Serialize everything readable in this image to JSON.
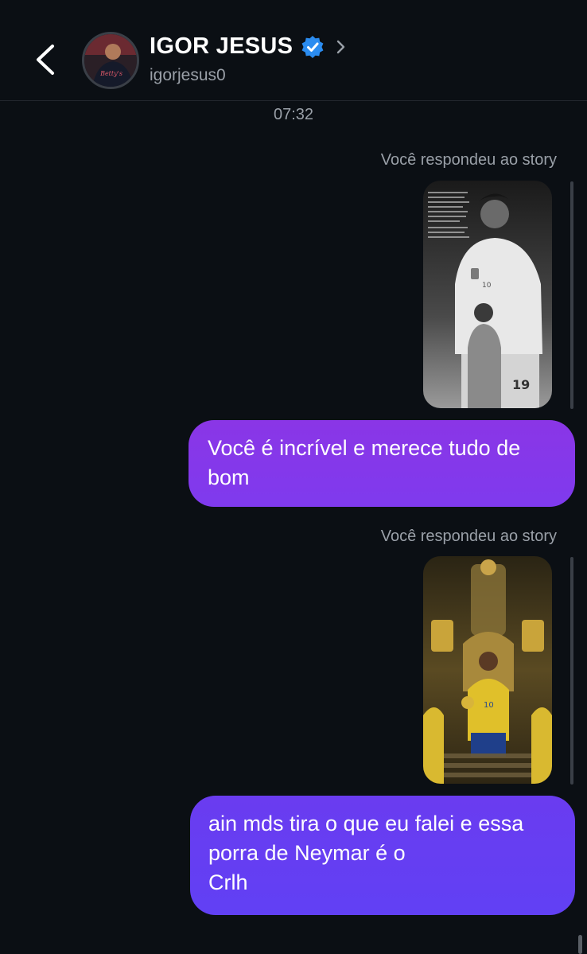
{
  "header": {
    "name": "IGOR JESUS",
    "handle": "igorjesus0",
    "back_icon": "chevron-left-icon",
    "verified_icon": "verified-badge-icon",
    "chevron_icon": "chevron-right-icon",
    "avatar_text": "Betty's"
  },
  "thread": {
    "time": "07:32",
    "reply_label_1": "Você respondeu ao story",
    "reply_label_2": "Você respondeu ao story",
    "message_1": "Você é incrível e merece tudo de bom",
    "message_2_lines": [
      "ain mds tira o que eu falei e essa",
      "porra de Neymar é o",
      "Crlh"
    ],
    "story_1_jersey": "19",
    "story_1_number": "10",
    "story_2_number": "10"
  },
  "colors": {
    "background": "#0b0f14",
    "bubble_1": "#8a36e6",
    "bubble_2": "#6a3cf0",
    "verified": "#2b8cf0",
    "muted_text": "#9aa0a8"
  }
}
